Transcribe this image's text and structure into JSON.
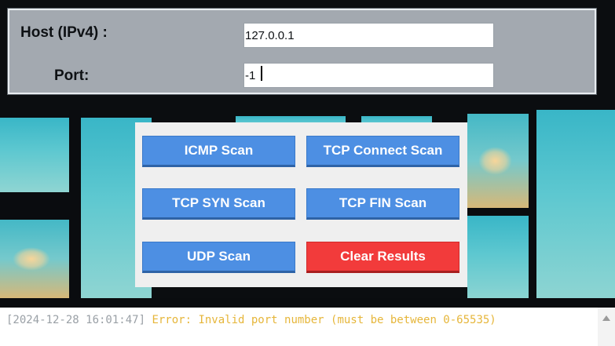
{
  "config": {
    "host_label": "Host (IPv4) :",
    "host_value": "127.0.0.1",
    "port_label": "Port:",
    "port_value": "-1"
  },
  "buttons": {
    "icmp": "ICMP Scan",
    "tcp_connect": "TCP Connect Scan",
    "tcp_syn": "TCP SYN Scan",
    "tcp_fin": "TCP FIN Scan",
    "udp": "UDP Scan",
    "clear": "Clear Results"
  },
  "log": {
    "timestamp": "[2024-12-28 16:01:47]",
    "message": " Error: Invalid port number (must be between 0-65535)"
  },
  "colors": {
    "scan_button": "#4d8fe3",
    "clear_button": "#f23b3b",
    "log_message": "#e6b63a",
    "panel_gray": "#a3a9b0"
  },
  "icons": {
    "scroll_up": "scroll-up-arrow-icon"
  }
}
